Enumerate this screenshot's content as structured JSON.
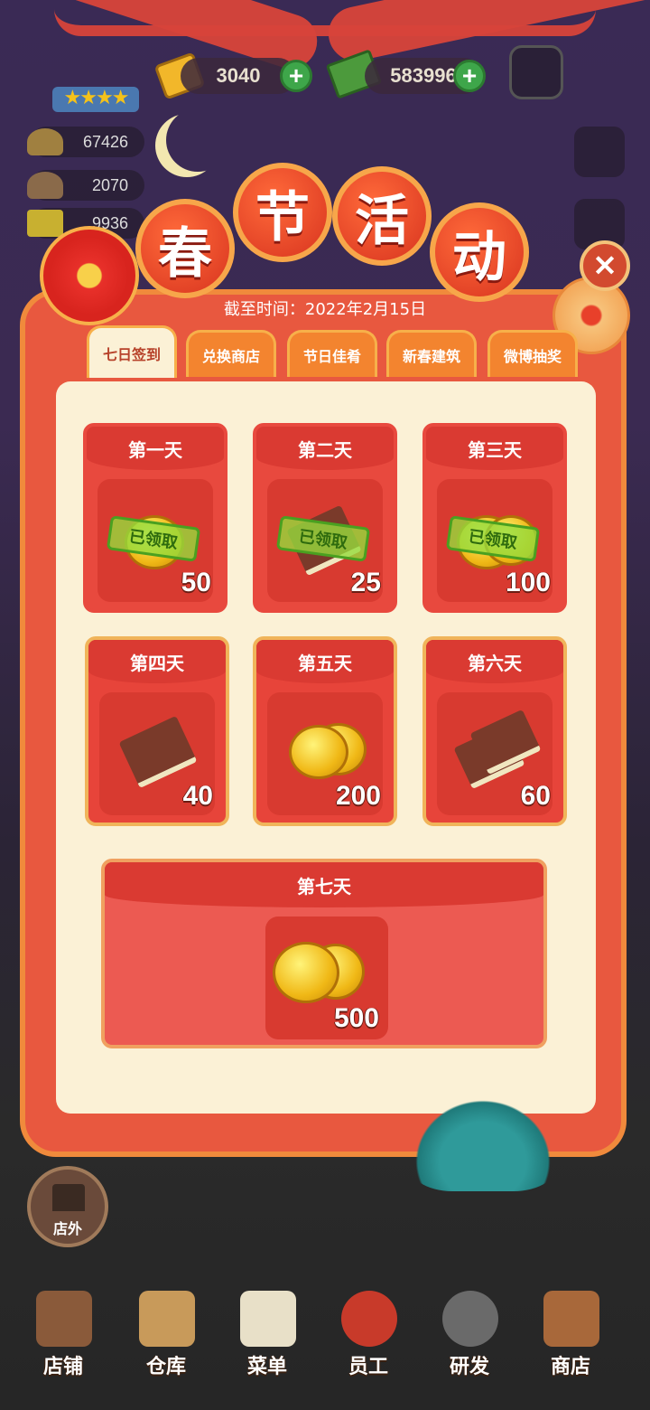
{
  "top_bar": {
    "gems": "3040",
    "cash": "583996"
  },
  "stats": [
    {
      "icon": "food-plate-icon",
      "value": "67426"
    },
    {
      "icon": "cloche-icon",
      "value": "2070"
    },
    {
      "icon": "book-stat-icon",
      "value": "9936"
    }
  ],
  "event": {
    "title_chars": [
      "春",
      "节",
      "活",
      "动"
    ],
    "deadline": "截至时间：2022年2月15日"
  },
  "tabs": [
    {
      "label": "七日签到",
      "active": true
    },
    {
      "label": "兑换商店",
      "active": false
    },
    {
      "label": "节日佳肴",
      "active": false
    },
    {
      "label": "新春建筑",
      "active": false
    },
    {
      "label": "微博抽奖",
      "active": false
    }
  ],
  "days": [
    {
      "label": "第一天",
      "item": "coin",
      "qty": "50",
      "status": "已领取"
    },
    {
      "label": "第二天",
      "item": "book",
      "qty": "25",
      "status": "已领取"
    },
    {
      "label": "第三天",
      "item": "coin",
      "qty": "100",
      "status": "已领取"
    },
    {
      "label": "第四天",
      "item": "book",
      "qty": "40",
      "status": ""
    },
    {
      "label": "第五天",
      "item": "coin",
      "qty": "200",
      "status": ""
    },
    {
      "label": "第六天",
      "item": "book",
      "qty": "60",
      "status": ""
    },
    {
      "label": "第七天",
      "item": "coin",
      "qty": "500",
      "status": ""
    }
  ],
  "outside_button": "店外",
  "nav": [
    {
      "label": "店铺",
      "icon": "store-icon"
    },
    {
      "label": "仓库",
      "icon": "warehouse-icon"
    },
    {
      "label": "菜单",
      "icon": "menu-icon"
    },
    {
      "label": "员工",
      "icon": "staff-icon"
    },
    {
      "label": "研发",
      "icon": "research-icon"
    },
    {
      "label": "商店",
      "icon": "shop-icon"
    }
  ]
}
